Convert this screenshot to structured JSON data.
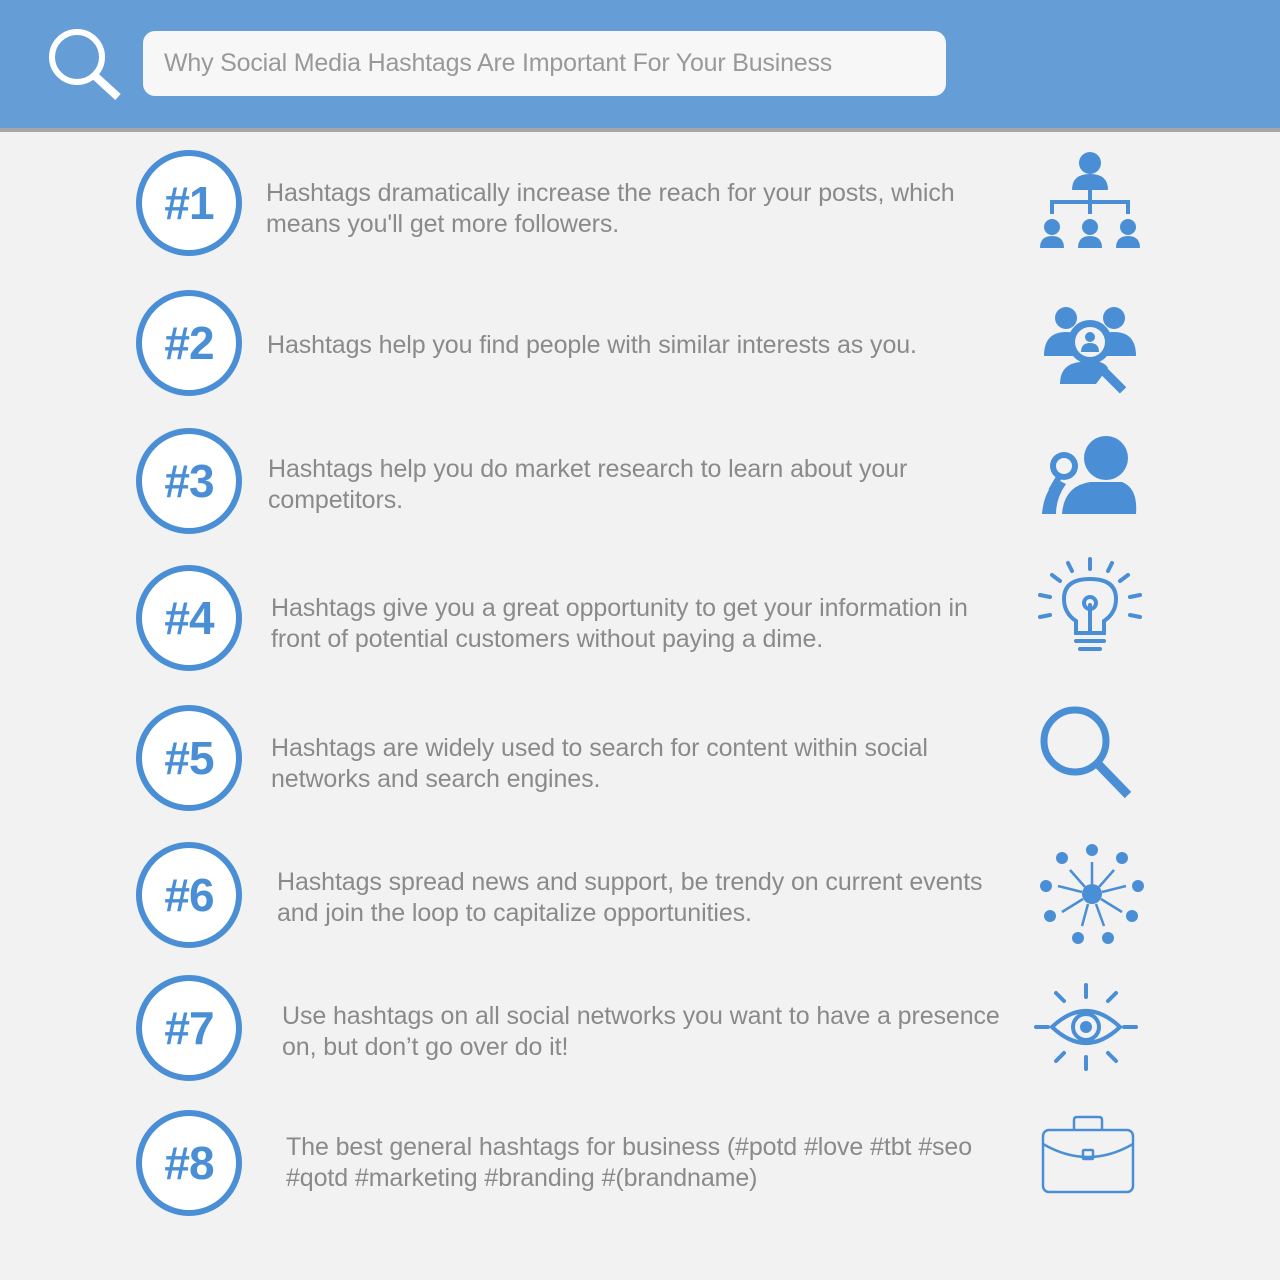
{
  "search": {
    "query": "Why Social Media Hashtags Are Important For Your Business"
  },
  "colors": {
    "header_bg": "#659dd6",
    "accent": "#4a8fd6",
    "background": "#f2f2f2",
    "text": "#8a8a8a"
  },
  "items": [
    {
      "number": "#1",
      "text": "Hashtags dramatically increase the reach for your posts, which means you'll get more followers.",
      "icon": "org-chart-icon"
    },
    {
      "number": "#2",
      "text": "Hashtags help you find people with similar interests as you.",
      "icon": "people-search-icon"
    },
    {
      "number": "#3",
      "text": "Hashtags help you do market research to learn about your competitors.",
      "icon": "researcher-magnifier-icon"
    },
    {
      "number": "#4",
      "text": "Hashtags give you a great opportunity to get your information in front of potential customers without paying a dime.",
      "icon": "lightbulb-icon"
    },
    {
      "number": "#5",
      "text": "Hashtags are widely used to search for content within social networks and search engines.",
      "icon": "magnifier-icon"
    },
    {
      "number": "#6",
      "text": "Hashtags spread news and support, be trendy on current events and join the loop to capitalize opportunities.",
      "icon": "network-spread-icon"
    },
    {
      "number": "#7",
      "text": "Use hashtags on all social networks you want to have a presence on, but don’t go over do it!",
      "icon": "eye-icon"
    },
    {
      "number": "#8",
      "text": "The best general hashtags for business (#potd #love #tbt #seo #qotd #marketing #branding #(brandname)",
      "icon": "briefcase-icon"
    }
  ]
}
